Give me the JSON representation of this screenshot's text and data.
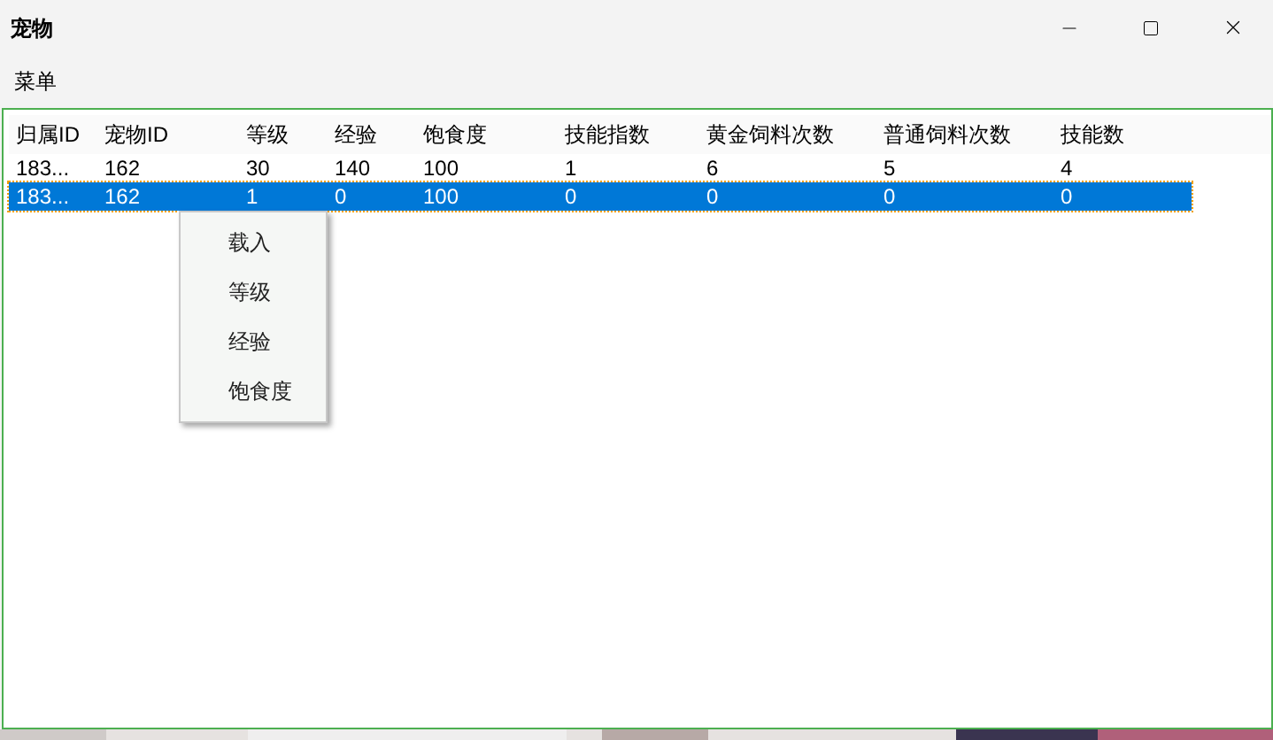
{
  "window": {
    "title": "宠物"
  },
  "menu_bar": [
    {
      "label": "菜单"
    }
  ],
  "table": {
    "columns": [
      "归属ID",
      "宠物ID",
      "等级",
      "经验",
      "饱食度",
      "技能指数",
      "黄金饲料次数",
      "普通饲料次数",
      "技能数"
    ],
    "rows": [
      {
        "selected": false,
        "cells": [
          "183...",
          "162",
          "30",
          "140",
          "100",
          "1",
          "6",
          "5",
          "4"
        ]
      },
      {
        "selected": true,
        "cells": [
          "183...",
          "162",
          "1",
          "0",
          "100",
          "0",
          "0",
          "0",
          "0"
        ]
      }
    ]
  },
  "context_menu": {
    "items": [
      {
        "label": "载入"
      },
      {
        "label": "等级"
      },
      {
        "label": "经验"
      },
      {
        "label": "饱食度"
      }
    ]
  }
}
